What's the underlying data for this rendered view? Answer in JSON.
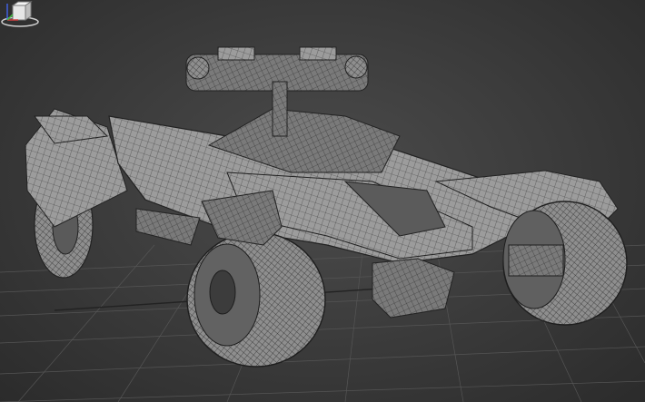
{
  "viewport": {
    "mode": "wireframe-shaded",
    "background": "#3a3a3a",
    "grid_color": "#5a5a5a",
    "model_color": "#9a9a9a",
    "wire_color": "#2a2a2a"
  },
  "viewcube": {
    "icon": "viewcube-icon"
  },
  "axis_tripod": {
    "icon": "axis-tripod-icon",
    "x_color": "#d04040",
    "y_color": "#40c040",
    "z_color": "#4060e0"
  }
}
